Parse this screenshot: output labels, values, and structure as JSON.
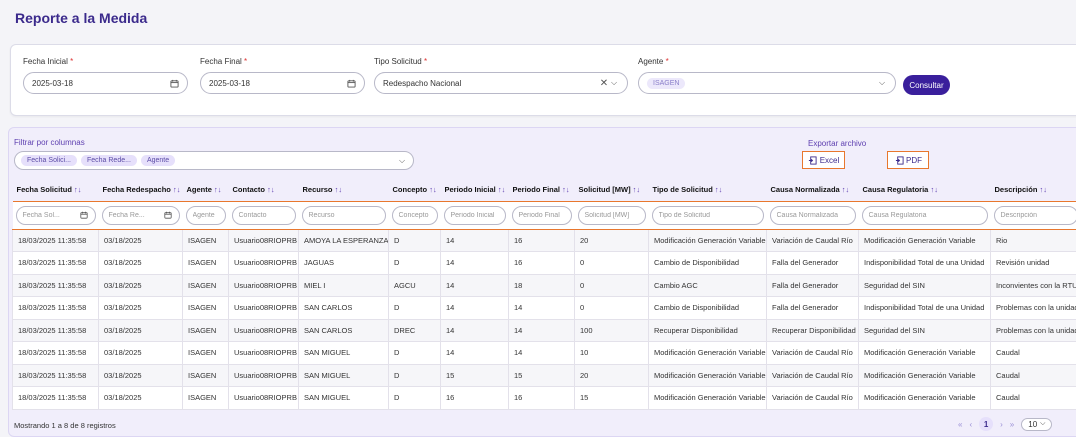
{
  "page_title": "Reporte a la Medida",
  "filters": {
    "fecha_inicial": {
      "label": "Fecha Inicial",
      "required": "*",
      "value": "2025-03-18"
    },
    "fecha_final": {
      "label": "Fecha Final",
      "required": "*",
      "value": "2025-03-18"
    },
    "tipo_solicitud": {
      "label": "Tipo Solicitud",
      "required": "*",
      "value": "Redespacho Nacional"
    },
    "agente": {
      "label": "Agente",
      "required": "*",
      "chip": "ISAGEN"
    },
    "consultar_label": "Consultar"
  },
  "column_filter": {
    "label": "Filtrar por columnas",
    "chips": [
      "Fecha Solici...",
      "Fecha Rede...",
      "Agente"
    ]
  },
  "export": {
    "label": "Exportar archivo",
    "excel_label": "Excel",
    "pdf_label": "PDF"
  },
  "table": {
    "sort_glyph": "↑↓",
    "columns": [
      {
        "header": "Fecha Solicitud",
        "placeholder": "Fecha Sol...",
        "date": true
      },
      {
        "header": "Fecha Redespacho",
        "placeholder": "Fecha Re...",
        "date": true
      },
      {
        "header": "Agente",
        "placeholder": "Agente"
      },
      {
        "header": "Contacto",
        "placeholder": "Contacto"
      },
      {
        "header": "Recurso",
        "placeholder": "Recurso"
      },
      {
        "header": "Concepto",
        "placeholder": "Concepto"
      },
      {
        "header": "Periodo Inicial",
        "placeholder": "Periodo Inicial"
      },
      {
        "header": "Periodo Final",
        "placeholder": "Periodo Final"
      },
      {
        "header": "Solicitud [MW]",
        "placeholder": "Solicitud [MW]"
      },
      {
        "header": "Tipo de Solicitud",
        "placeholder": "Tipo de Solicitud"
      },
      {
        "header": "Causa Normalizada",
        "placeholder": "Causa Normalizada"
      },
      {
        "header": "Causa Regulatoria",
        "placeholder": "Causa Regulatoria"
      },
      {
        "header": "Descripción",
        "placeholder": "Descripción"
      }
    ],
    "rows": [
      [
        "18/03/2025 11:35:58",
        "03/18/2025",
        "ISAGEN",
        "Usuario08RIOPRB",
        "AMOYA LA ESPERANZA",
        "D",
        "14",
        "16",
        "20",
        "Modificación Generación Variable",
        "Variación de Caudal Río",
        "Modificación Generación Variable",
        "Rio"
      ],
      [
        "18/03/2025 11:35:58",
        "03/18/2025",
        "ISAGEN",
        "Usuario08RIOPRB",
        "JAGUAS",
        "D",
        "14",
        "16",
        "0",
        "Cambio de Disponibilidad",
        "Falla del Generador",
        "Indisponibilidad Total de una Unidad",
        "Revisión unidad"
      ],
      [
        "18/03/2025 11:35:58",
        "03/18/2025",
        "ISAGEN",
        "Usuario08RIOPRB",
        "MIEL I",
        "AGCU",
        "14",
        "18",
        "0",
        "Cambio AGC",
        "Falla del Generador",
        "Seguridad del SIN",
        "Inconvientes con la RTU"
      ],
      [
        "18/03/2025 11:35:58",
        "03/18/2025",
        "ISAGEN",
        "Usuario08RIOPRB",
        "SAN CARLOS",
        "D",
        "14",
        "14",
        "0",
        "Cambio de Disponibilidad",
        "Falla del Generador",
        "Indisponibilidad Total de una Unidad",
        "Problemas con la unidad"
      ],
      [
        "18/03/2025 11:35:58",
        "03/18/2025",
        "ISAGEN",
        "Usuario08RIOPRB",
        "SAN CARLOS",
        "DREC",
        "14",
        "14",
        "100",
        "Recuperar Disponibilidad",
        "Recuperar Disponibilidad",
        "Seguridad del SIN",
        "Problemas con la unidad"
      ],
      [
        "18/03/2025 11:35:58",
        "03/18/2025",
        "ISAGEN",
        "Usuario08RIOPRB",
        "SAN MIGUEL",
        "D",
        "14",
        "14",
        "10",
        "Modificación Generación Variable",
        "Variación de Caudal Río",
        "Modificación Generación Variable",
        "Caudal"
      ],
      [
        "18/03/2025 11:35:58",
        "03/18/2025",
        "ISAGEN",
        "Usuario08RIOPRB",
        "SAN MIGUEL",
        "D",
        "15",
        "15",
        "20",
        "Modificación Generación Variable",
        "Variación de Caudal Río",
        "Modificación Generación Variable",
        "Caudal"
      ],
      [
        "18/03/2025 11:35:58",
        "03/18/2025",
        "ISAGEN",
        "Usuario08RIOPRB",
        "SAN MIGUEL",
        "D",
        "16",
        "16",
        "15",
        "Modificación Generación Variable",
        "Variación de Caudal Río",
        "Modificación Generación Variable",
        "Caudal"
      ]
    ]
  },
  "footer": {
    "records_text": "Mostrando 1 a 8 de 8 registros",
    "pager": {
      "first": "«",
      "prev": "‹",
      "current": "1",
      "next": "›",
      "last": "»",
      "page_size": "10"
    }
  },
  "icons": {
    "calendar": "calendar-icon",
    "clear": "close-icon",
    "chevron": "chevron-down-icon",
    "export": "export-icon"
  },
  "colors": {
    "primary": "#3a1f9c",
    "accent_orange": "#e8772e",
    "tint": "#f1eefb"
  }
}
